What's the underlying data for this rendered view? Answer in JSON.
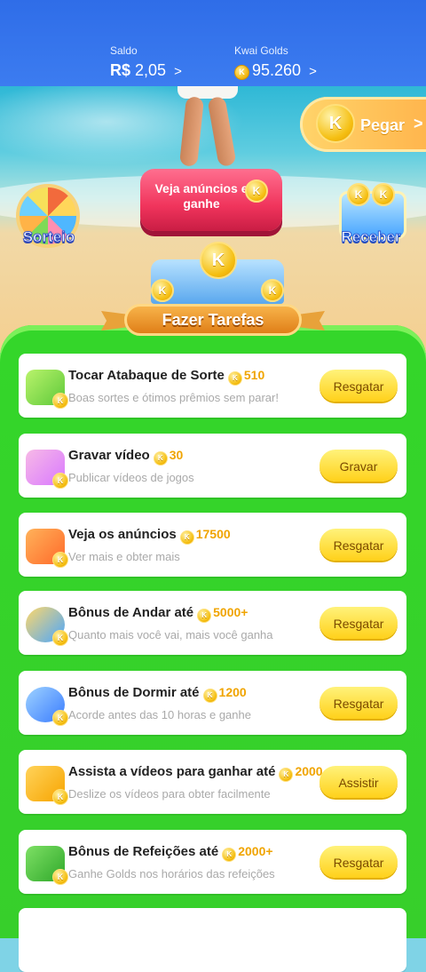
{
  "header": {
    "saldo_label": "Saldo",
    "saldo_currency": "R$",
    "saldo_value": "2,05",
    "golds_label": "Kwai Golds",
    "golds_value": "95.260",
    "chevron": ">"
  },
  "scene": {
    "ads_button": "Veja anúncios e ganhe",
    "pegar_label": "Pegar",
    "pegar_chevron": ">",
    "sorteio_label": "Sorteio",
    "receber_label": "Receber",
    "banner_label": "Fazer Tarefas",
    "coin_letter": "K"
  },
  "tasks": [
    {
      "title": "Tocar Atabaque de Sorte",
      "reward": "510",
      "subtitle": "Boas sortes e ótimos prêmios sem parar!",
      "action": "Resgatar",
      "icon": "drum-icon"
    },
    {
      "title": "Gravar vídeo",
      "reward": "30",
      "subtitle": "Publicar vídeos de jogos",
      "action": "Gravar",
      "icon": "video-camera-icon"
    },
    {
      "title": "Veja os anúncios",
      "reward": "17500",
      "subtitle": "Ver mais e obter mais",
      "action": "Resgatar",
      "icon": "tv-icon"
    },
    {
      "title": "Bônus de Andar até",
      "reward": "5000+",
      "subtitle": "Quanto mais você vai, mais você ganha",
      "action": "Resgatar",
      "icon": "walking-boy-icon"
    },
    {
      "title": "Bônus de Dormir até",
      "reward": "1200",
      "subtitle": "Acorde antes das 10 horas e ganhe",
      "action": "Resgatar",
      "icon": "moon-icon"
    },
    {
      "title": "Assista a vídeos para ganhar até",
      "reward": "2000",
      "subtitle": "Deslize os vídeos para obter facilmente",
      "action": "Assistir",
      "icon": "movie-camera-icon"
    },
    {
      "title": "Bônus de Refeições até",
      "reward": "2000+",
      "subtitle": "Ganhe Golds nos horários das refeições",
      "action": "Resgatar",
      "icon": "meal-bag-icon"
    }
  ]
}
